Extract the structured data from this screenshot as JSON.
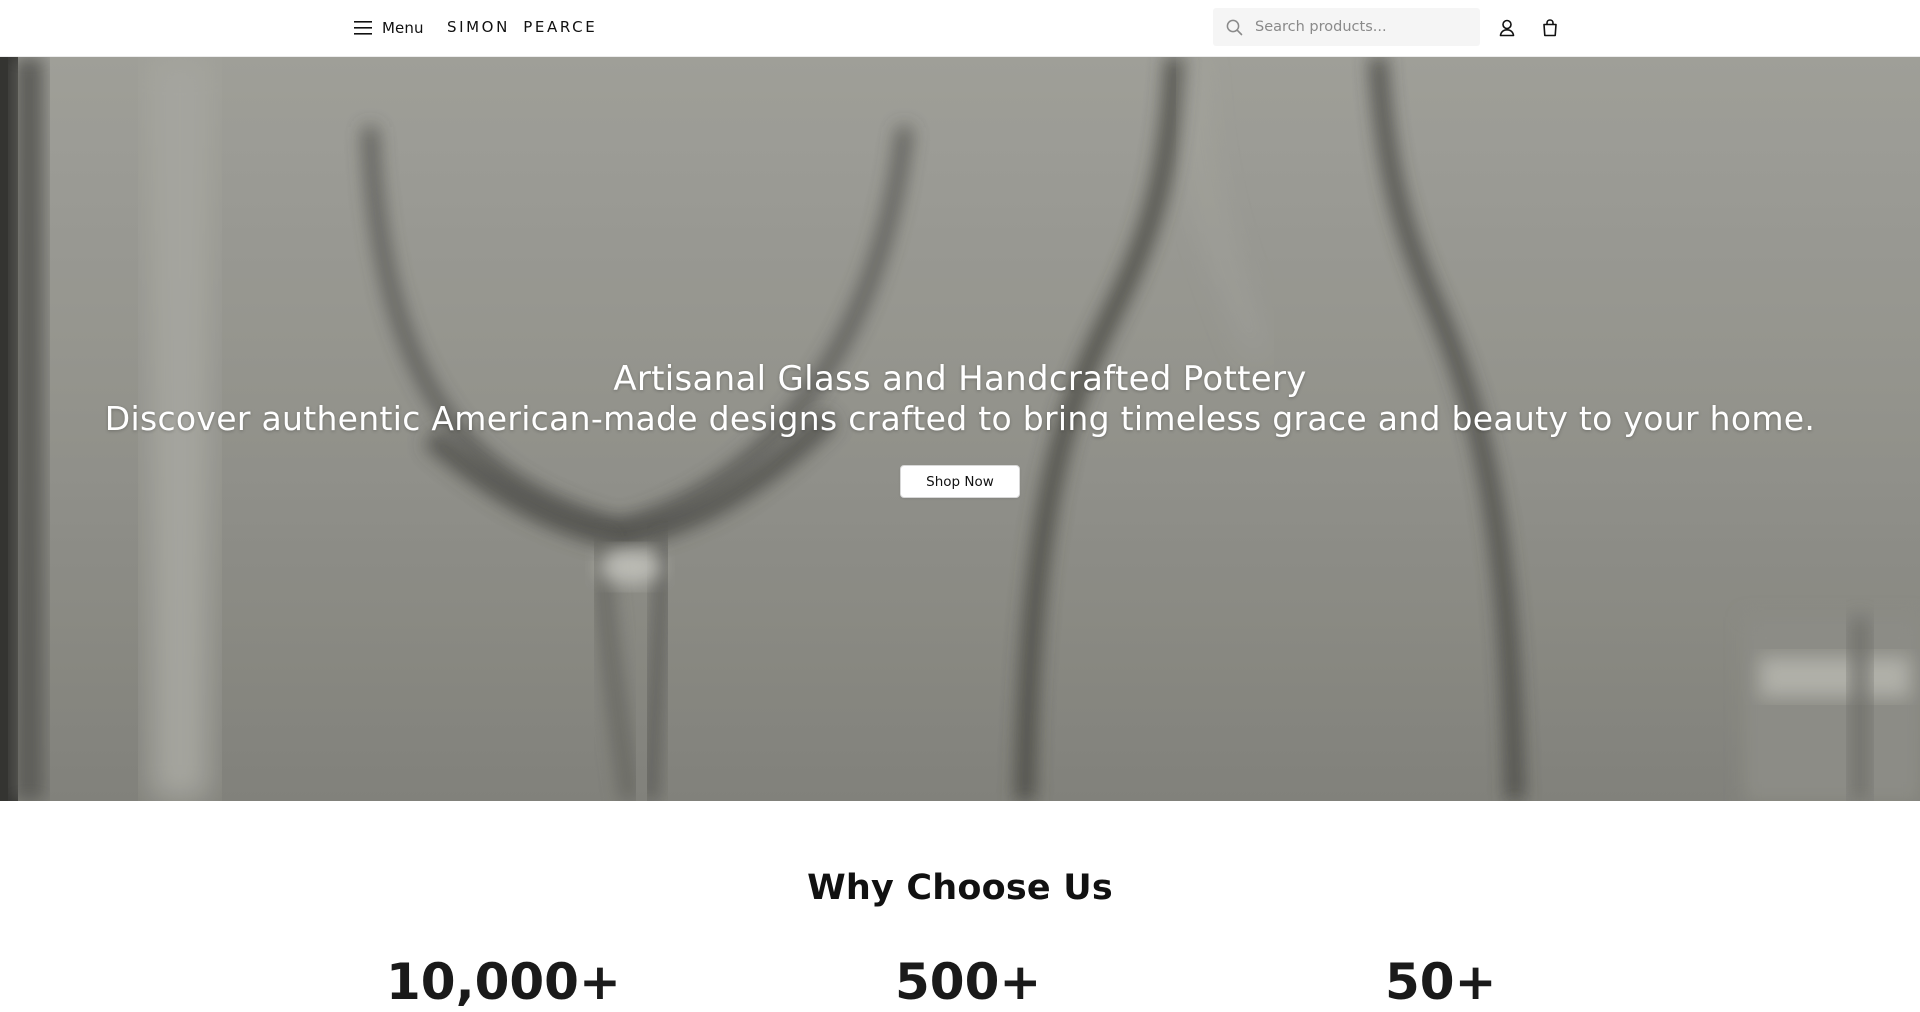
{
  "header": {
    "menu_label": "Menu",
    "logo_text": "SIMON PEARCE",
    "search_placeholder": "Search products...",
    "icons": [
      "menu-icon",
      "search-icon",
      "user-icon",
      "shopping-bag-icon"
    ]
  },
  "hero": {
    "title": "Artisanal Glass and Handcrafted Pottery",
    "subtitle": "Discover authentic American-made designs crafted to bring timeless grace and beauty to your home.",
    "cta_label": "Shop Now"
  },
  "why": {
    "title": "Why Choose Us",
    "stats": [
      {
        "value": "10,000+"
      },
      {
        "value": "500+"
      },
      {
        "value": "50+"
      }
    ]
  },
  "colors": {
    "text": "#111111",
    "hero_overlay": "#8b8b86",
    "search_bg": "#f5f5f5"
  }
}
